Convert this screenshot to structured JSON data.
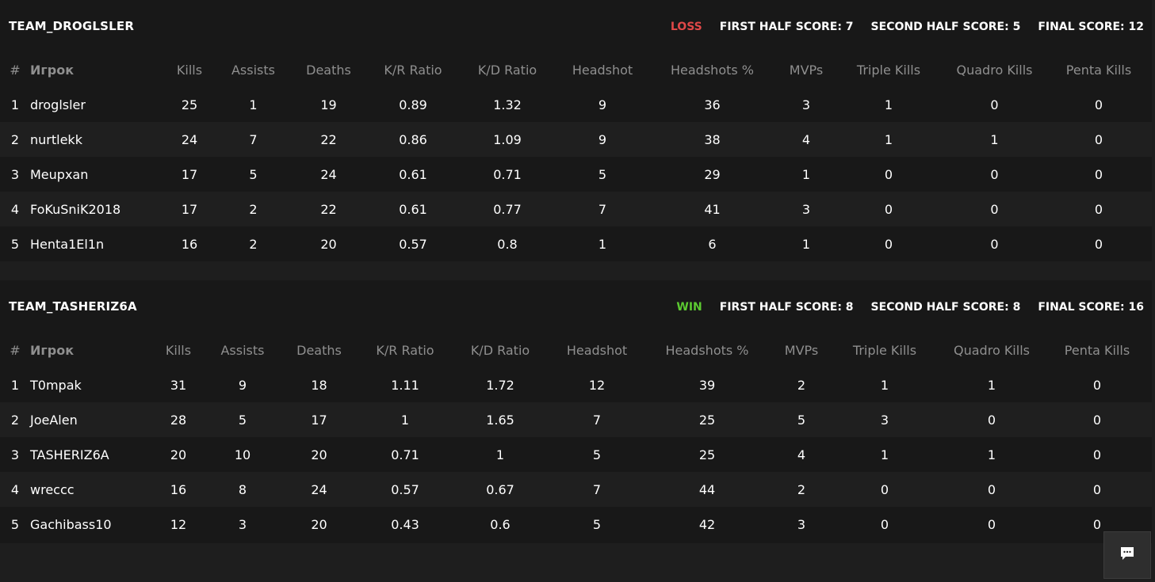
{
  "columns": [
    "#",
    "Игрок",
    "Kills",
    "Assists",
    "Deaths",
    "K/R Ratio",
    "K/D Ratio",
    "Headshot",
    "Headshots %",
    "MVPs",
    "Triple Kills",
    "Quadro Kills",
    "Penta Kills"
  ],
  "teams": [
    {
      "name": "TEAM_DROGLSLER",
      "result": "LOSS",
      "first_half": "FIRST HALF SCORE: 7",
      "second_half": "SECOND HALF SCORE: 5",
      "final": "FINAL SCORE: 12",
      "rows": [
        [
          "1",
          "droglsler",
          "25",
          "1",
          "19",
          "0.89",
          "1.32",
          "9",
          "36",
          "3",
          "1",
          "0",
          "0"
        ],
        [
          "2",
          "nurtlekk",
          "24",
          "7",
          "22",
          "0.86",
          "1.09",
          "9",
          "38",
          "4",
          "1",
          "1",
          "0"
        ],
        [
          "3",
          "Meupxan",
          "17",
          "5",
          "24",
          "0.61",
          "0.71",
          "5",
          "29",
          "1",
          "0",
          "0",
          "0"
        ],
        [
          "4",
          "FoKuSniK2018",
          "17",
          "2",
          "22",
          "0.61",
          "0.77",
          "7",
          "41",
          "3",
          "0",
          "0",
          "0"
        ],
        [
          "5",
          "Henta1El1n",
          "16",
          "2",
          "20",
          "0.57",
          "0.8",
          "1",
          "6",
          "1",
          "0",
          "0",
          "0"
        ]
      ]
    },
    {
      "name": "TEAM_TASHERIZ6A",
      "result": "WIN",
      "first_half": "FIRST HALF SCORE: 8",
      "second_half": "SECOND HALF SCORE: 8",
      "final": "FINAL SCORE: 16",
      "rows": [
        [
          "1",
          "T0mpak",
          "31",
          "9",
          "18",
          "1.11",
          "1.72",
          "12",
          "39",
          "2",
          "1",
          "1",
          "0"
        ],
        [
          "2",
          "JoeAlen",
          "28",
          "5",
          "17",
          "1",
          "1.65",
          "7",
          "25",
          "5",
          "3",
          "0",
          "0"
        ],
        [
          "3",
          "TASHERIZ6A",
          "20",
          "10",
          "20",
          "0.71",
          "1",
          "5",
          "25",
          "4",
          "1",
          "1",
          "0"
        ],
        [
          "4",
          "wreccc",
          "16",
          "8",
          "24",
          "0.57",
          "0.67",
          "7",
          "44",
          "2",
          "0",
          "0",
          "0"
        ],
        [
          "5",
          "Gachibass10",
          "12",
          "3",
          "20",
          "0.43",
          "0.6",
          "5",
          "42",
          "3",
          "0",
          "0",
          "0"
        ]
      ]
    }
  ],
  "colors": {
    "loss": "#e04848",
    "win": "#5cc931",
    "background": "#1e1e1e"
  },
  "chat": {
    "icon": "chat-bubble-icon"
  }
}
